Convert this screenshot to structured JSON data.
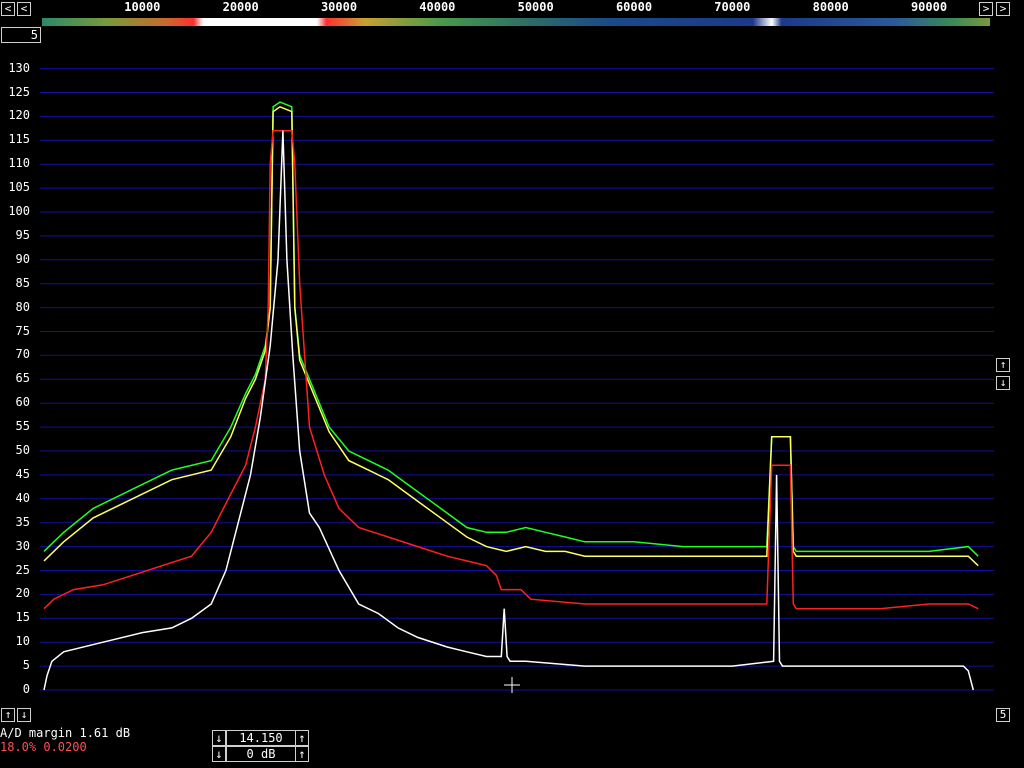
{
  "freq_scale": {
    "labels": [
      "10000",
      "20000",
      "30000",
      "40000",
      "50000",
      "60000",
      "70000",
      "80000",
      "90000"
    ],
    "values": [
      10000,
      20000,
      30000,
      40000,
      50000,
      60000,
      70000,
      80000,
      90000
    ]
  },
  "top_left_button": "<",
  "top_right_button": ">",
  "corner_indicator": "5",
  "right_up_arrow": "↑",
  "right_down_arrow": "↓",
  "bottom_left_up_arrow": "↑",
  "bottom_left_down_arrow": "↓",
  "bottom_right_indicator": "5",
  "status": {
    "ad_margin": "A/D margin 1.61 dB",
    "level": "18.0% 0.0200"
  },
  "control_box": {
    "frequency": "14.150",
    "gain": "0 dB",
    "down_arrow": "↓",
    "up_arrow": "↑"
  },
  "colors": {
    "grid": "#1010a0",
    "green": "#20ff20",
    "yellow": "#ffff60",
    "red": "#ff2020",
    "white": "#ffffff"
  },
  "chart_data": {
    "type": "line",
    "x_range": [
      0,
      96000
    ],
    "ylim": [
      0,
      130
    ],
    "yticks": [
      0,
      5,
      10,
      15,
      20,
      25,
      30,
      35,
      40,
      45,
      50,
      55,
      60,
      65,
      70,
      75,
      80,
      85,
      90,
      95,
      100,
      105,
      110,
      115,
      120,
      125,
      130
    ],
    "grid": true,
    "series": [
      {
        "color": "green",
        "x": [
          0,
          2000,
          5000,
          9000,
          13000,
          17000,
          19000,
          20500,
          21500,
          22500,
          23000,
          23300,
          24000,
          25200,
          25500,
          26000,
          27000,
          29000,
          31000,
          33000,
          35000,
          37000,
          39000,
          41000,
          43000,
          45000,
          47000,
          49000,
          51000,
          53000,
          55000,
          60000,
          65000,
          70000,
          73500,
          74000,
          75900,
          76200,
          76500,
          78000,
          80000,
          85000,
          90000,
          94000,
          95000
        ],
        "y": [
          29,
          33,
          38,
          42,
          46,
          48,
          55,
          62,
          66,
          72,
          80,
          122,
          123,
          122,
          80,
          70,
          65,
          55,
          50,
          48,
          46,
          43,
          40,
          37,
          34,
          33,
          33,
          34,
          33,
          32,
          31,
          31,
          30,
          30,
          30,
          53,
          53,
          30,
          29,
          29,
          29,
          29,
          29,
          30,
          28
        ]
      },
      {
        "color": "yellow",
        "x": [
          0,
          2000,
          5000,
          9000,
          13000,
          17000,
          19000,
          20500,
          21500,
          22500,
          23000,
          23300,
          24000,
          25200,
          25500,
          26000,
          27000,
          29000,
          31000,
          33000,
          35000,
          37000,
          39000,
          41000,
          43000,
          45000,
          47000,
          49000,
          51000,
          53000,
          55000,
          60000,
          65000,
          70000,
          73500,
          74000,
          75900,
          76200,
          76500,
          78000,
          80000,
          85000,
          90000,
          94000,
          95000
        ],
        "y": [
          27,
          31,
          36,
          40,
          44,
          46,
          53,
          61,
          65,
          71,
          80,
          121,
          122,
          121,
          80,
          69,
          64,
          54,
          48,
          46,
          44,
          41,
          38,
          35,
          32,
          30,
          29,
          30,
          29,
          29,
          28,
          28,
          28,
          28,
          28,
          53,
          53,
          29,
          28,
          28,
          28,
          28,
          28,
          28,
          26
        ]
      },
      {
        "color": "red",
        "x": [
          0,
          1000,
          3000,
          6000,
          9000,
          12000,
          15000,
          17000,
          19000,
          20500,
          21500,
          22500,
          22800,
          23000,
          23300,
          24000,
          25200,
          25500,
          26000,
          27000,
          28500,
          30000,
          32000,
          35000,
          38000,
          41000,
          43000,
          45000,
          46000,
          46500,
          47000,
          48500,
          49500,
          55000,
          60000,
          65000,
          70000,
          73500,
          74000,
          75900,
          76200,
          76500,
          80000,
          85000,
          90000,
          94000,
          95000
        ],
        "y": [
          17,
          19,
          21,
          22,
          24,
          26,
          28,
          33,
          41,
          47,
          55,
          65,
          80,
          110,
          117,
          117,
          117,
          110,
          85,
          55,
          45,
          38,
          34,
          32,
          30,
          28,
          27,
          26,
          24,
          21,
          21,
          21,
          19,
          18,
          18,
          18,
          18,
          18,
          47,
          47,
          18,
          17,
          17,
          17,
          18,
          18,
          17
        ]
      },
      {
        "color": "white",
        "x": [
          0,
          300,
          800,
          2000,
          6000,
          10000,
          13000,
          15000,
          17000,
          18500,
          20000,
          21000,
          22000,
          23000,
          23800,
          24300,
          24700,
          25300,
          26000,
          27000,
          28000,
          30000,
          32000,
          34000,
          36000,
          38000,
          41000,
          43000,
          45000,
          46500,
          46800,
          47100,
          47400,
          49000,
          55000,
          60000,
          65000,
          70000,
          74200,
          74500,
          74800,
          75100,
          75400,
          80000,
          85000,
          90000,
          93500,
          94000,
          94500
        ],
        "y": [
          0,
          3,
          6,
          8,
          10,
          12,
          13,
          15,
          18,
          25,
          37,
          45,
          57,
          72,
          90,
          117,
          90,
          70,
          50,
          37,
          34,
          25,
          18,
          16,
          13,
          11,
          9,
          8,
          7,
          7,
          17,
          7,
          6,
          6,
          5,
          5,
          5,
          5,
          6,
          45,
          6,
          5,
          5,
          5,
          5,
          5,
          5,
          4,
          0
        ]
      }
    ]
  }
}
